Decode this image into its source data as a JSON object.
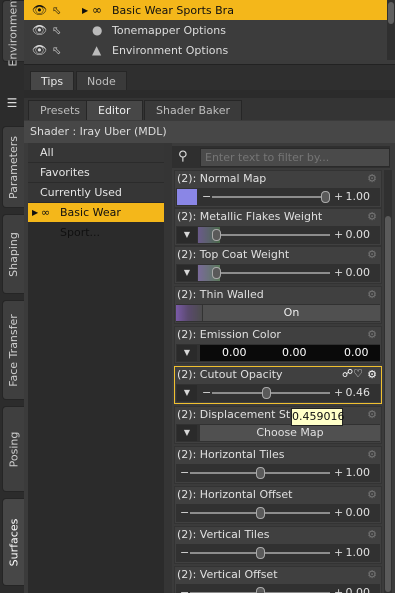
{
  "vertical_tabs": [
    "Environment",
    "Parameters",
    "Shaping",
    "Face Transfer",
    "Posing",
    "Surfaces"
  ],
  "scene": {
    "rows": [
      {
        "label": "Basic Wear Sports Bra",
        "selected": true,
        "icon": "figure-icon"
      },
      {
        "label": "Tonemapper Options",
        "selected": false,
        "icon": "camera-icon"
      },
      {
        "label": "Environment Options",
        "selected": false,
        "icon": "environment-icon"
      }
    ]
  },
  "tabs_top": [
    "Tips",
    "Node"
  ],
  "tabs_editor": [
    "Presets",
    "Editor",
    "Shader Baker"
  ],
  "shader_label": "Shader : Iray Uber (MDL)",
  "categories": [
    "All",
    "Favorites",
    "Currently Used",
    "Basic Wear Sport..."
  ],
  "filter_placeholder": "Enter text to filter by...",
  "properties": [
    {
      "title": "(2): Normal Map",
      "kind": "swatch-slider",
      "value": "1.00",
      "fraction": 0.96
    },
    {
      "title": "(2): Metallic Flakes Weight",
      "kind": "dd-slider",
      "value": "0.00",
      "fraction": 0.0
    },
    {
      "title": "(2): Top Coat Weight",
      "kind": "dd-slider",
      "value": "0.00",
      "fraction": 0.0
    },
    {
      "title": "(2): Thin Walled",
      "kind": "toggle",
      "value": "On"
    },
    {
      "title": "(2): Emission Color",
      "kind": "color",
      "r": "0.00",
      "g": "0.00",
      "b": "0.00"
    },
    {
      "title": "(2): Cutout Opacity",
      "kind": "dd-slider",
      "value": "0.46",
      "fraction": 0.46
    },
    {
      "title": "(2): Displacement Streng",
      "kind": "map",
      "value": "Choose Map"
    },
    {
      "title": "(2): Horizontal Tiles",
      "kind": "slider",
      "value": "1.00",
      "fraction": 0.5
    },
    {
      "title": "(2): Horizontal Offset",
      "kind": "slider",
      "value": "0.00",
      "fraction": 0.5
    },
    {
      "title": "(2): Vertical Tiles",
      "kind": "slider",
      "value": "1.00",
      "fraction": 0.5
    },
    {
      "title": "(2): Vertical Offset",
      "kind": "slider",
      "value": "0.00",
      "fraction": 0.5
    }
  ],
  "tooltip": "0.459016"
}
